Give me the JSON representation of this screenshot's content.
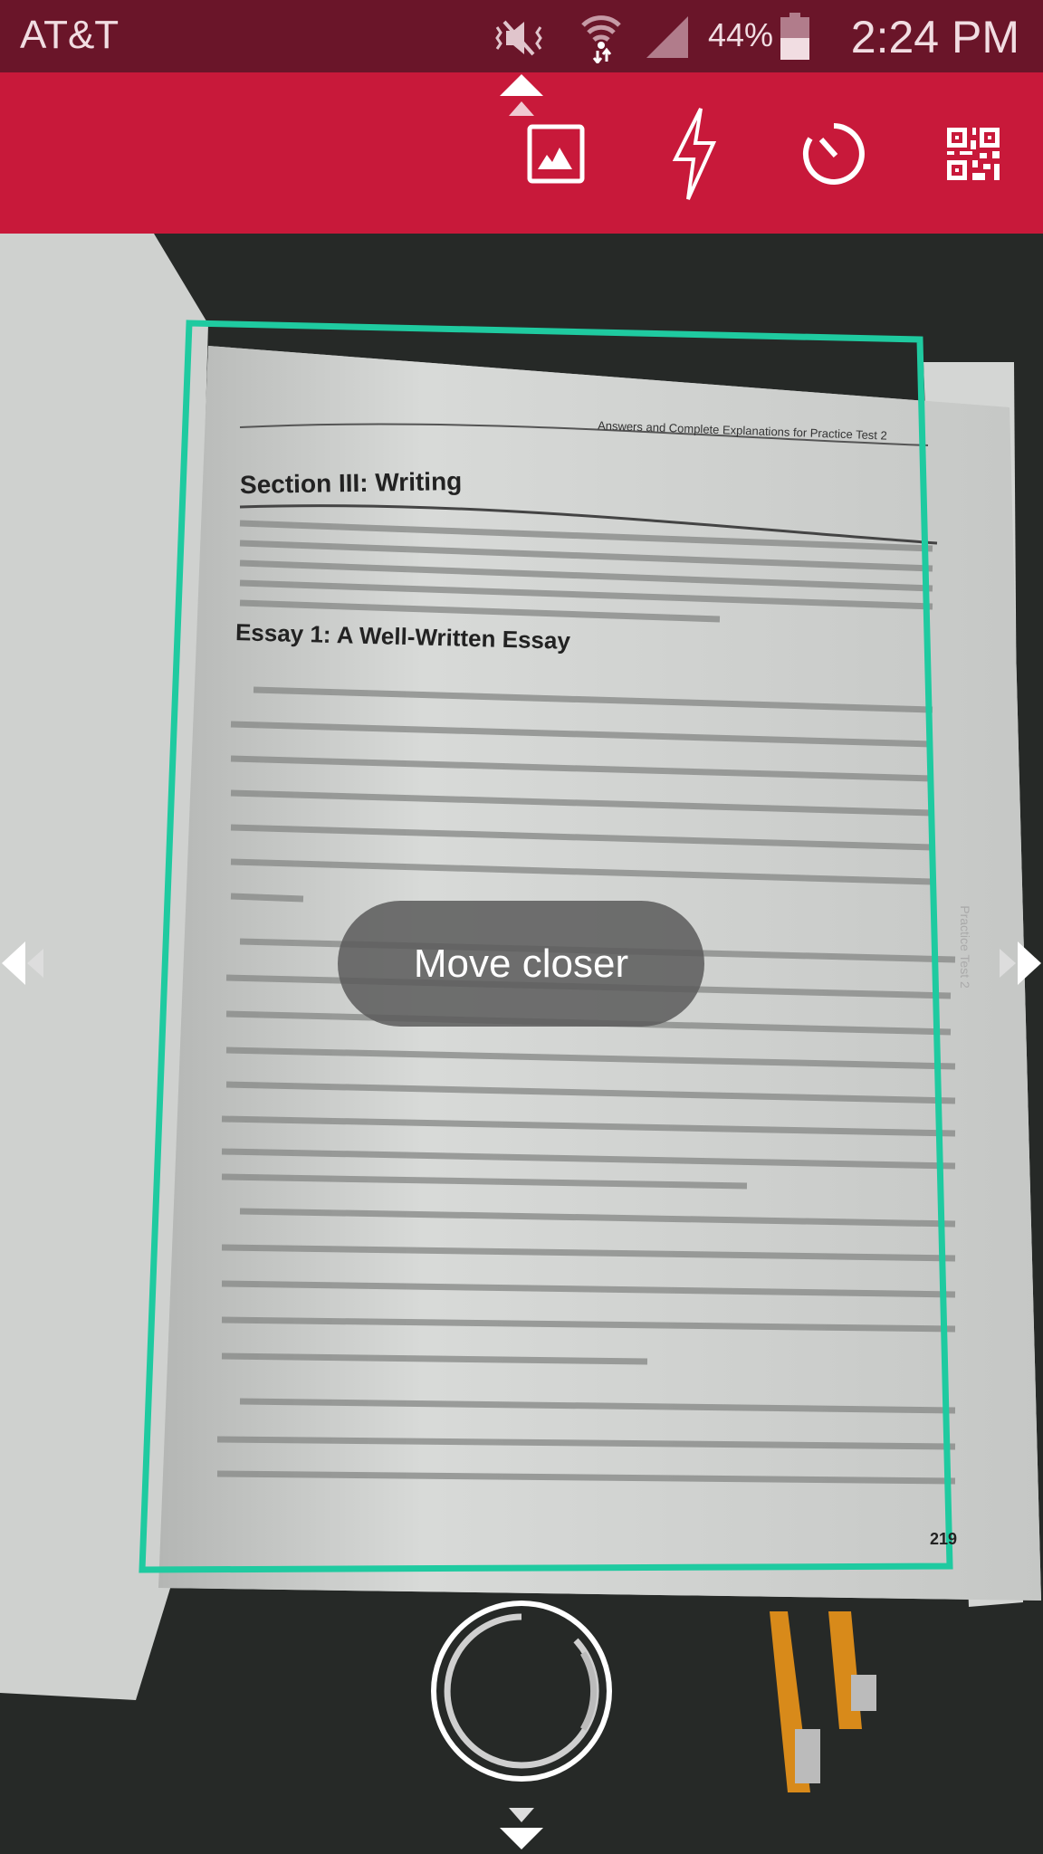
{
  "status_bar": {
    "carrier": "AT&T",
    "battery": "44%",
    "time": "2:24 PM",
    "icons": [
      "vibrate-mute-icon",
      "wifi-icon",
      "signal-icon",
      "battery-icon"
    ]
  },
  "toolbar": {
    "buttons": [
      {
        "icon": "gallery-icon"
      },
      {
        "icon": "flash-icon"
      },
      {
        "icon": "timer-icon"
      },
      {
        "icon": "qr-code-icon"
      }
    ]
  },
  "document": {
    "running_header": "Answers and Complete Explanations for Practice Test 2",
    "section_title": "Section III: Writing",
    "essay_title": "Essay 1: A Well-Written Essay",
    "page_number": "219",
    "side_tab": "Practice Test 2"
  },
  "toast": {
    "message": "Move closer"
  },
  "colors": {
    "status_bar": "#6a1529",
    "toolbar": "#c8193a",
    "detection_frame": "#1fcaa0"
  }
}
